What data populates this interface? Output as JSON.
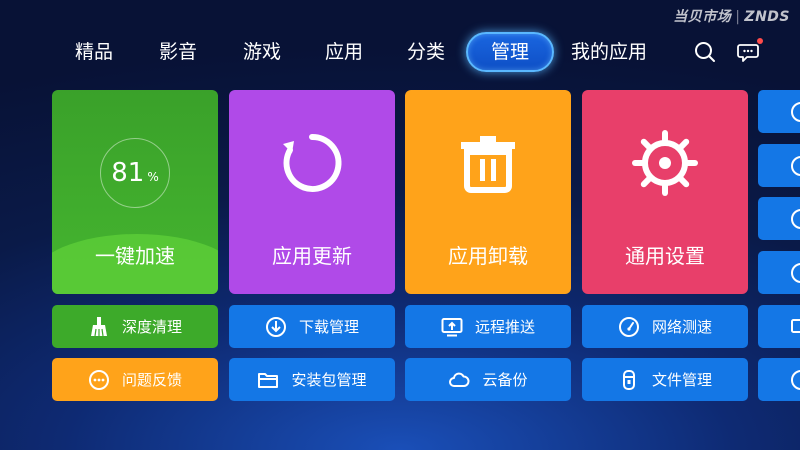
{
  "watermark": {
    "brand": "当贝市场",
    "partner": "ZNDS"
  },
  "nav": {
    "items": [
      "精品",
      "影音",
      "游戏",
      "应用",
      "分类",
      "管理",
      "我的应用"
    ],
    "active_index": 5
  },
  "tiles": {
    "speedup": {
      "label": "一键加速",
      "value": "81",
      "unit": "%"
    },
    "update": {
      "label": "应用更新"
    },
    "uninstall": {
      "label": "应用卸载"
    },
    "settings": {
      "label": "通用设置"
    }
  },
  "buttons": {
    "deep_clean": "深度清理",
    "download_manage": "下载管理",
    "remote_push": "远程推送",
    "network_speed": "网络测速",
    "feedback": "问题反馈",
    "package_manage": "安装包管理",
    "cloud_backup": "云备份",
    "file_manage": "文件管理"
  },
  "colors": {
    "green": "#3daa2a",
    "purple": "#b04ae8",
    "orange": "#ffa31a",
    "pink": "#e83f6a",
    "blue": "#1477e6",
    "nav_active": "#1a66e0"
  }
}
